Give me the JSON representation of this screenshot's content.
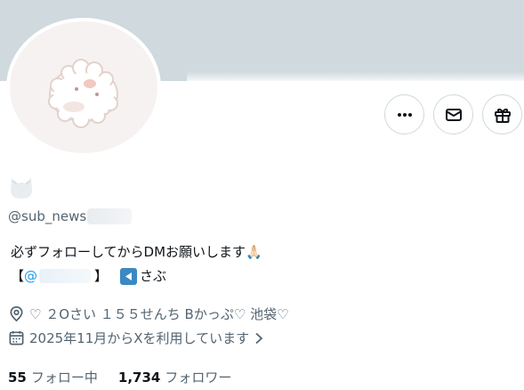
{
  "profile": {
    "handle_visible": "@sub_news",
    "bio_line1": "必ずフォローしてからDMお願いします🙏🏻",
    "bio_line2_open": "【",
    "bio_mention": "@",
    "bio_line2_close": "】",
    "bio_line2_tail": "さぶ",
    "location": "♡ ２Oさい １５５せんち Bかっぷ♡ 池袋♡",
    "joined": "2025年11月からXを利用しています",
    "following_count": "55",
    "following_label": "フォロー中",
    "followers_count": "1,734",
    "followers_label": "フォロワー"
  },
  "icons": {
    "more": "more-horizontal-icon",
    "message": "envelope-icon",
    "gift": "gift-icon",
    "location": "location-pin-icon",
    "calendar": "calendar-icon",
    "chevron": "chevron-right-icon",
    "back": "back-arrow-emoji-icon",
    "name_emoji": "cat-ears-emoji-icon"
  },
  "colors": {
    "banner": "#cfd9de",
    "accent": "#1d9bf0",
    "secondary_text": "#536471",
    "primary_text": "#0f1419"
  }
}
